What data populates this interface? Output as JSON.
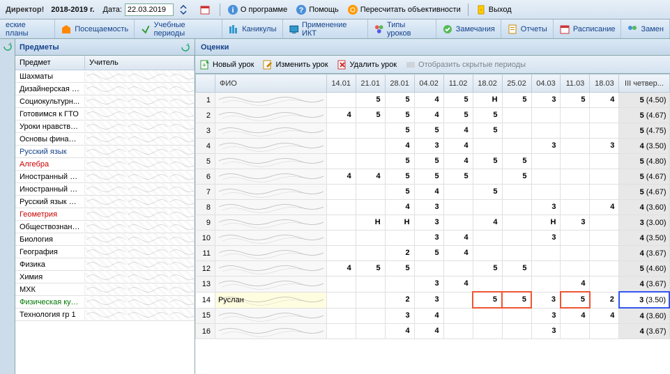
{
  "top": {
    "role": "Директор!",
    "year": "2018-2019 г.",
    "date_label": "Дата:",
    "date_value": "22.03.2019",
    "about": "О программе",
    "help": "Помощь",
    "recalc": "Пересчитать объективности",
    "exit": "Выход"
  },
  "nav": {
    "plans": "еские планы",
    "attendance": "Посещаемость",
    "periods": "Учебные периоды",
    "holidays": "Каникулы",
    "ikt": "Применение ИКТ",
    "lesson_types": "Типы уроков",
    "remarks": "Замечания",
    "reports": "Отчеты",
    "schedule": "Расписание",
    "subst": "Замен"
  },
  "subjects": {
    "title": "Предметы",
    "col1": "Предмет",
    "col2": "Учитель",
    "items": [
      {
        "name": "Шахматы",
        "cls": ""
      },
      {
        "name": "Дизайнерская м...",
        "cls": ""
      },
      {
        "name": "Социокультурн...",
        "cls": ""
      },
      {
        "name": "Готовимся к ГТО",
        "cls": ""
      },
      {
        "name": "Уроки нравстве...",
        "cls": ""
      },
      {
        "name": "Основы финанс...",
        "cls": ""
      },
      {
        "name": "Русский язык",
        "cls": "blue-text"
      },
      {
        "name": "Алгебра",
        "cls": "red-text"
      },
      {
        "name": "Иностранный яз...",
        "cls": ""
      },
      {
        "name": "Иностранный яз...",
        "cls": ""
      },
      {
        "name": "Русский язык и ...",
        "cls": ""
      },
      {
        "name": "Геометрия",
        "cls": "red-text"
      },
      {
        "name": "Обществознание",
        "cls": ""
      },
      {
        "name": "Биология",
        "cls": ""
      },
      {
        "name": "География",
        "cls": ""
      },
      {
        "name": "Физика",
        "cls": ""
      },
      {
        "name": "Химия",
        "cls": ""
      },
      {
        "name": "МХК",
        "cls": ""
      },
      {
        "name": "Физическая кул...",
        "cls": "green-text"
      },
      {
        "name": "Технология гр 1",
        "cls": ""
      }
    ]
  },
  "grades": {
    "title": "Оценки",
    "tb": {
      "new": "Новый урок",
      "edit": "Изменить урок",
      "del": "Удалить урок",
      "show": "Отобразить скрытые периоды"
    },
    "fio_label": "ФИО",
    "dates": [
      "14.01",
      "21.01",
      "28.01",
      "04.02",
      "11.02",
      "18.02",
      "25.02",
      "04.03",
      "11.03",
      "18.03"
    ],
    "summary_label": "III четвер...",
    "rows": [
      {
        "n": 1,
        "fio": "",
        "g": [
          "",
          "",
          "5",
          "5",
          "4",
          "5",
          "Н",
          "5",
          "3",
          "5",
          "4"
        ],
        "s": "5",
        "avg": "(4.50)"
      },
      {
        "n": 2,
        "fio": "",
        "g": [
          "",
          "4",
          "5",
          "5",
          "4",
          "5",
          "5",
          "",
          "",
          "",
          ""
        ],
        "s": "5",
        "avg": "(4.67)"
      },
      {
        "n": 3,
        "fio": "",
        "g": [
          "",
          "",
          "",
          "5",
          "5",
          "4",
          "5",
          "",
          "",
          "",
          ""
        ],
        "s": "5",
        "avg": "(4.75)"
      },
      {
        "n": 4,
        "fio": "",
        "g": [
          "",
          "",
          "",
          "4",
          "3",
          "4",
          "",
          "",
          "3",
          "",
          "3",
          "4"
        ],
        "s": "4",
        "avg": "(3.50)"
      },
      {
        "n": 5,
        "fio": "",
        "g": [
          "",
          "",
          "",
          "5",
          "5",
          "4",
          "5",
          "5",
          "",
          "",
          "",
          ""
        ],
        "s": "5",
        "avg": "(4.80)"
      },
      {
        "n": 6,
        "fio": "",
        "g": [
          "",
          "4",
          "4",
          "5",
          "5",
          "5",
          "",
          "5",
          "",
          "",
          "",
          ""
        ],
        "s": "5",
        "avg": "(4.67)"
      },
      {
        "n": 7,
        "fio": "",
        "g": [
          "",
          "",
          "",
          "5",
          "4",
          "",
          "5",
          "",
          "",
          "",
          "",
          ""
        ],
        "s": "5",
        "avg": "(4.67)"
      },
      {
        "n": 8,
        "fio": "",
        "g": [
          "",
          "",
          "",
          "4",
          "3",
          "",
          "",
          "",
          "3",
          "",
          "4",
          ""
        ],
        "s": "4",
        "avg": "(3.60)"
      },
      {
        "n": 9,
        "fio": "",
        "g": [
          "",
          "",
          "Н",
          "Н",
          "3",
          "",
          "4",
          "",
          "Н",
          "3",
          "",
          ""
        ],
        "s": "3",
        "avg": "(3.00)"
      },
      {
        "n": 10,
        "fio": "",
        "g": [
          "",
          "",
          "",
          "",
          "3",
          "4",
          "",
          "",
          "3",
          "",
          "",
          "4"
        ],
        "s": "4",
        "avg": "(3.50)"
      },
      {
        "n": 11,
        "fio": "",
        "g": [
          "",
          "",
          "",
          "2",
          "5",
          "4",
          "",
          "",
          "",
          "",
          "",
          ""
        ],
        "s": "4",
        "avg": "(3.67)"
      },
      {
        "n": 12,
        "fio": "",
        "g": [
          "",
          "4",
          "5",
          "5",
          "",
          "",
          "5",
          "5",
          "",
          "",
          "",
          ""
        ],
        "s": "5",
        "avg": "(4.60)"
      },
      {
        "n": 13,
        "fio": "",
        "g": [
          "",
          "",
          "",
          "",
          "3",
          "4",
          "",
          "",
          "",
          "4",
          "",
          ""
        ],
        "s": "4",
        "avg": "(3.67)"
      },
      {
        "n": 14,
        "fio": "Руслан",
        "g": [
          "",
          "",
          "",
          "2",
          "3",
          "",
          "5",
          "5",
          "3",
          "5",
          "2",
          "3"
        ],
        "s": "3",
        "avg": "(3.50)",
        "hl": true,
        "red": [
          6,
          7,
          9
        ],
        "blue_sum": true
      },
      {
        "n": 15,
        "fio": "",
        "g": [
          "",
          "",
          "",
          "3",
          "4",
          "",
          "",
          "",
          "3",
          "4",
          "4",
          ""
        ],
        "s": "4",
        "avg": "(3.60)"
      },
      {
        "n": 16,
        "fio": "",
        "g": [
          "",
          "",
          "",
          "4",
          "4",
          "",
          "",
          "",
          "3",
          "",
          "",
          ""
        ],
        "s": "4",
        "avg": "(3.67)"
      }
    ]
  }
}
